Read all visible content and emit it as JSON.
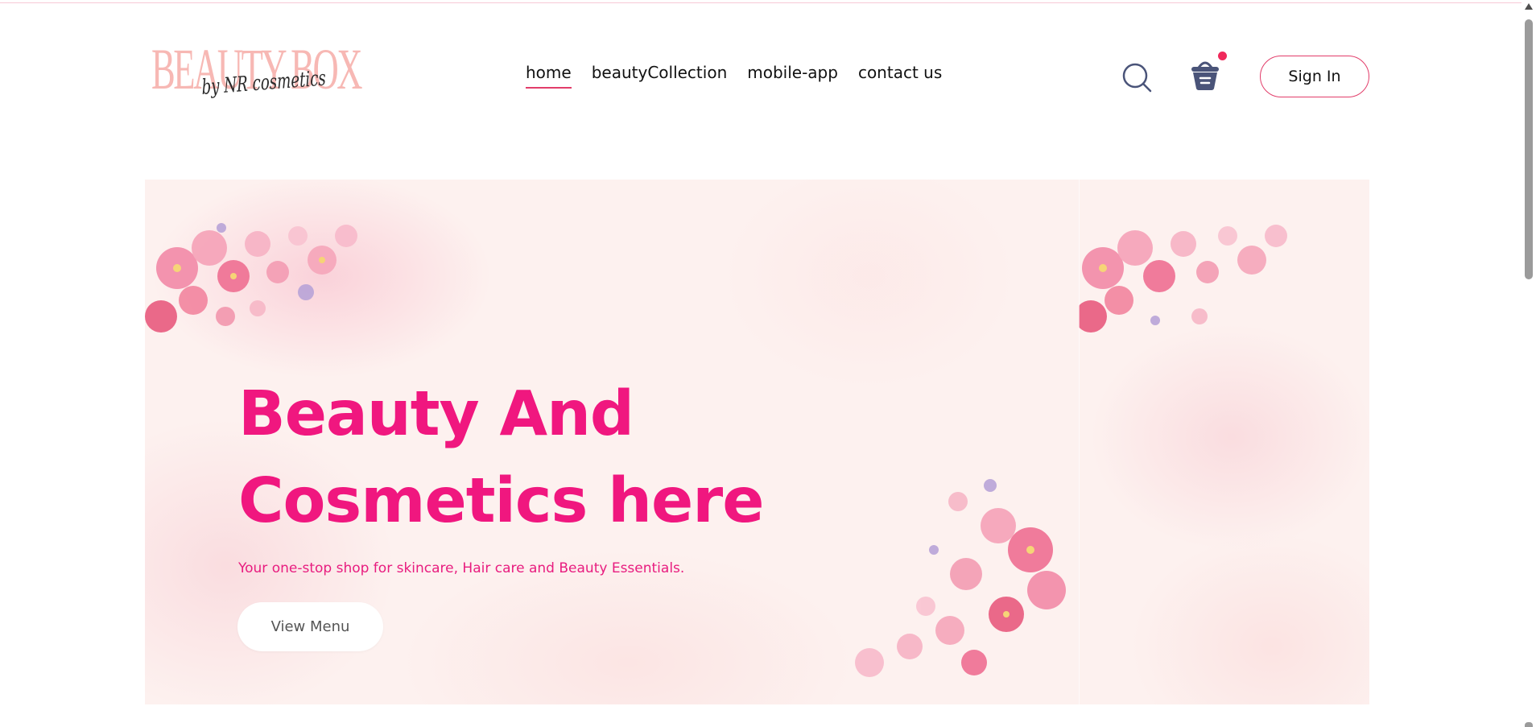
{
  "header": {
    "logo": {
      "main_text": "BEAUTY BOX",
      "sub_text": "by NR cosmetics",
      "alt": "BEAUTY BOX by NR cosmetics logo"
    },
    "nav": [
      {
        "label": "home",
        "active": true
      },
      {
        "label": "beautyCollection",
        "active": false
      },
      {
        "label": "mobile-app",
        "active": false
      },
      {
        "label": "contact us",
        "active": false
      }
    ],
    "search_icon": "search-icon",
    "cart_icon": "basket-icon",
    "cart_has_items": true,
    "signin_label": "Sign In"
  },
  "hero": {
    "title_line1": "Beauty And",
    "title_line2": "Cosmetics here",
    "subtitle": "Your one-stop shop for skincare, Hair care and Beauty Essentials.",
    "cta_label": "View Menu"
  },
  "colors": {
    "accent": "#f0177f",
    "nav_underline": "#e23d6a",
    "badge": "#f0295b",
    "icon": "#4a5479",
    "logo_pink": "#f7b8b4"
  }
}
